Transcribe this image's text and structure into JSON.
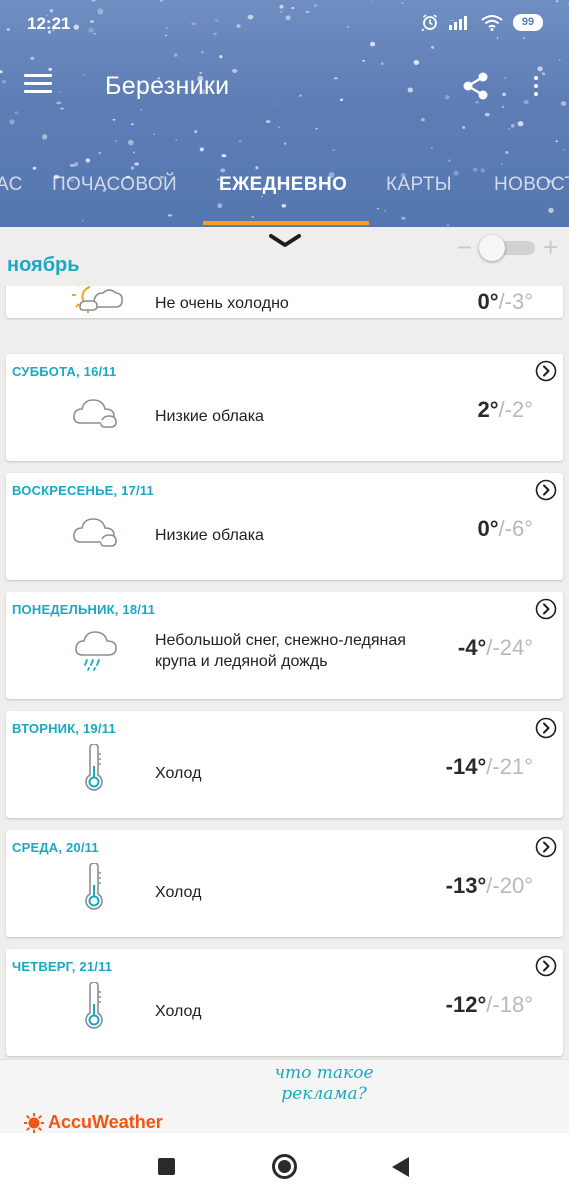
{
  "status_bar": {
    "time": "12:21",
    "battery": "99"
  },
  "toolbar": {
    "city": "Березники"
  },
  "tabs": [
    {
      "label": "АС"
    },
    {
      "label": "ПОЧАСОВОЙ"
    },
    {
      "label": "ЕЖЕДНЕВНО"
    },
    {
      "label": "КАРТЫ"
    },
    {
      "label": "НОВОСТ"
    }
  ],
  "active_tab": "ЕЖЕДНЕВНО",
  "month": {
    "label": "ноябрь",
    "toggle_minus": "−",
    "toggle_plus": "+"
  },
  "days": [
    {
      "date": "",
      "icon": "partly-sunny-icon",
      "phrase": "Не очень холодно",
      "hi": "0°",
      "lo": "/-3°"
    },
    {
      "date": "СУББОТА, 16/11",
      "icon": "cloud-icon",
      "phrase": "Низкие облака",
      "hi": "2°",
      "lo": "/-2°"
    },
    {
      "date": "ВОСКРЕСЕНЬЕ, 17/11",
      "icon": "cloud-icon",
      "phrase": "Низкие облака",
      "hi": "0°",
      "lo": "/-6°"
    },
    {
      "date": "ПОНЕДЕЛЬНИК, 18/11",
      "icon": "snow-rain-cloud-icon",
      "phrase": "Небольшой снег, снежно-ледяная крупа и ледяной дождь",
      "hi": "-4°",
      "lo": "/-24°"
    },
    {
      "date": "ВТОРНИК, 19/11",
      "icon": "thermometer-cold-icon",
      "phrase": "Холод",
      "hi": "-14°",
      "lo": "/-21°"
    },
    {
      "date": "СРЕДА, 20/11",
      "icon": "thermometer-cold-icon",
      "phrase": "Холод",
      "hi": "-13°",
      "lo": "/-20°"
    },
    {
      "date": "ЧЕТВЕРГ, 21/11",
      "icon": "thermometer-cold-icon",
      "phrase": "Холод",
      "hi": "-12°",
      "lo": "/-18°"
    }
  ],
  "ad": {
    "what_is_ad": "что такое реклама?",
    "brand": "AccuWeather"
  },
  "colors": {
    "accent": "#1aa9c4",
    "tab_indicator": "#f2a41c",
    "header": "#5d7db5",
    "brand": "#f05514"
  }
}
